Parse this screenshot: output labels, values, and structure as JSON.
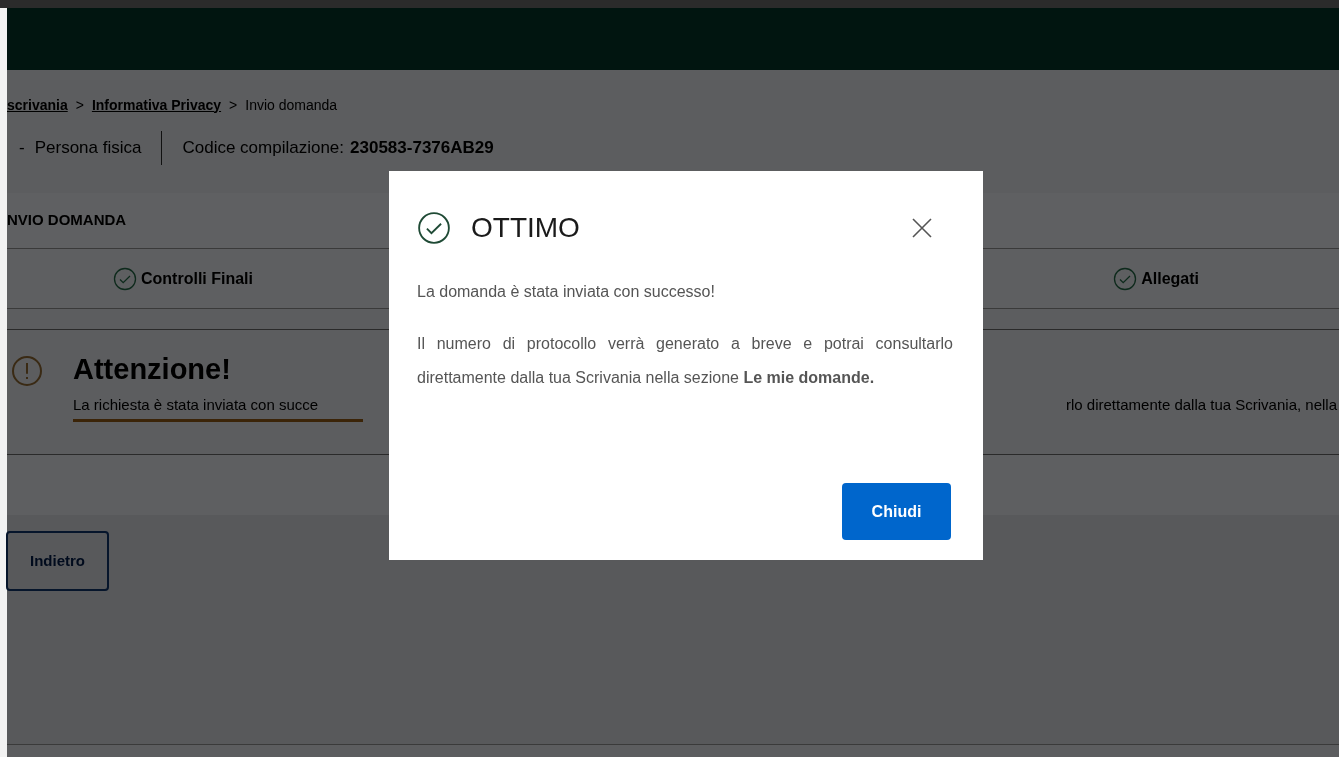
{
  "breadcrumb": [
    {
      "label": "scrivania",
      "link": true
    },
    {
      "label": ">",
      "link": false
    },
    {
      "label": "Informativa Privacy",
      "link": true
    },
    {
      "label": ">",
      "link": false
    },
    {
      "label": "Invio domanda",
      "link": false
    }
  ],
  "applicant": {
    "prefix": "-",
    "subject": "Persona fisica",
    "code_label": "Codice compilazione:",
    "code_value": "230583-7376AB29"
  },
  "section_title": "NVIO DOMANDA",
  "steps": [
    {
      "label": "Controlli Finali",
      "done": true
    },
    {
      "label": "Allegati",
      "done": true
    }
  ],
  "alert": {
    "title": "Attenzione!",
    "text_left": "La richiesta è stata inviata con succe",
    "text_right": "rlo direttamente dalla tua Scrivania, nella"
  },
  "back_button": "Indietro",
  "modal": {
    "title": "OTTIMO",
    "paragraphs": [
      "La domanda è stata inviata con successo!",
      "Il numero di protocollo verrà generato a breve e potrai consultarlo direttamente dalla tua Scrivania nella sezione **Le mie domande.**"
    ],
    "button": "Chiudi"
  }
}
